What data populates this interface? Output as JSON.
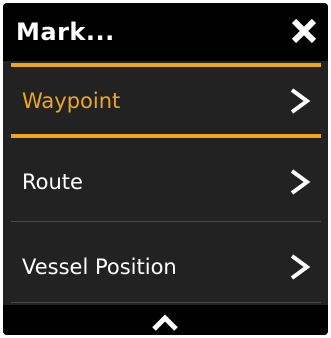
{
  "dialog": {
    "title": "Mark...",
    "close_icon": "close-icon",
    "scroll_icon": "chevron-up-icon"
  },
  "menu": {
    "items": [
      {
        "label": "Waypoint",
        "selected": true,
        "chevron_icon": "chevron-right-icon"
      },
      {
        "label": "Route",
        "selected": false,
        "chevron_icon": "chevron-right-icon"
      },
      {
        "label": "Vessel Position",
        "selected": false,
        "chevron_icon": "chevron-right-icon"
      }
    ]
  },
  "colors": {
    "background": "#222222",
    "header": "#000000",
    "accent": "#f0a51e",
    "text": "#ffffff"
  }
}
